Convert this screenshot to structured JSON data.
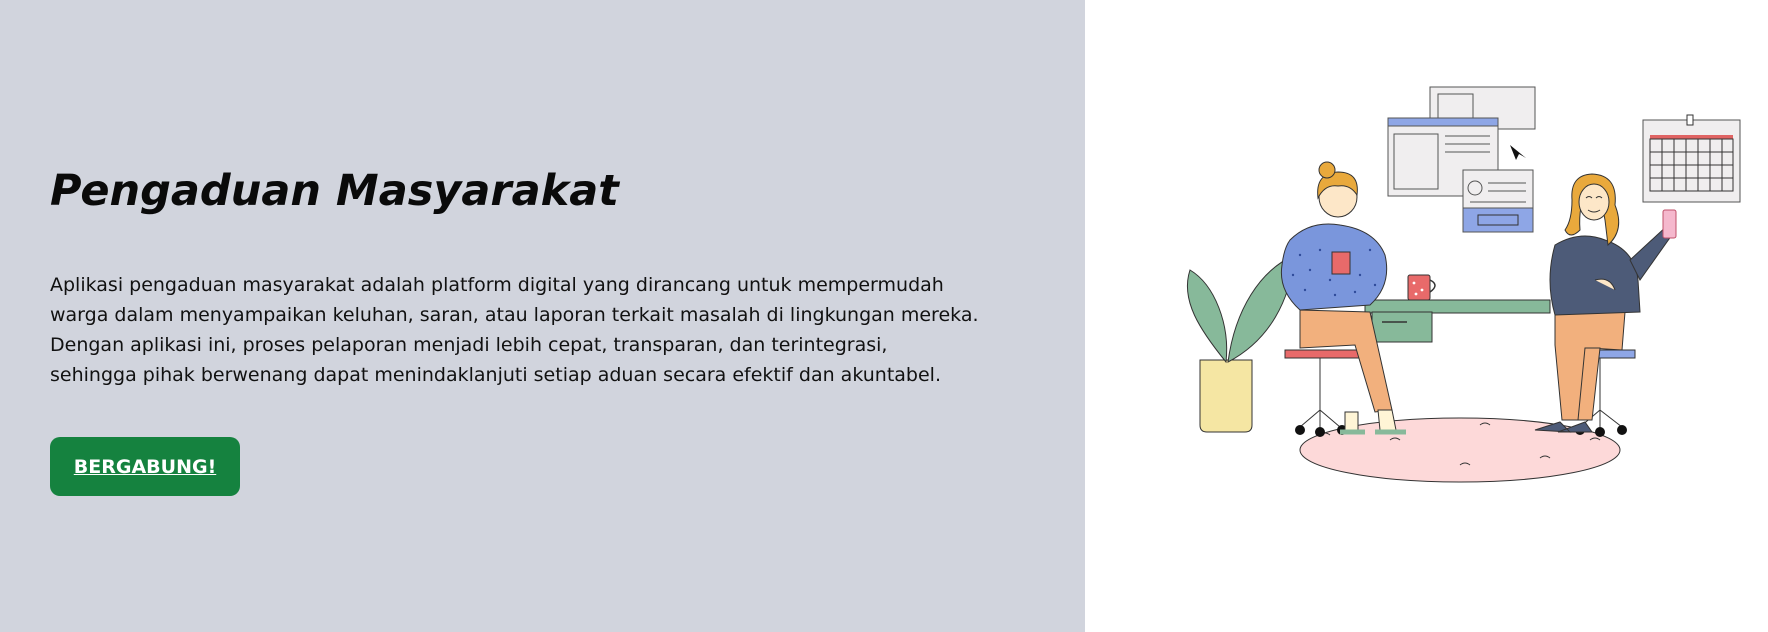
{
  "hero": {
    "title": "Pengaduan Masyarakat",
    "description_lines": [
      "Aplikasi pengaduan masyarakat adalah platform digital yang dirancang untuk mempermudah",
      "warga dalam menyampaikan keluhan, saran, atau laporan terkait masalah di lingkungan mereka.",
      "Dengan aplikasi ini, proses pelaporan menjadi lebih cepat, transparan, dan terintegrasi,",
      "sehingga pihak berwenang dapat menindaklanjuti setiap aduan secara efektif dan akuntabel."
    ],
    "button_label": "BERGABUNG!"
  },
  "colors": {
    "left_panel_bg": "#d1d4dd",
    "button_bg": "#15823f",
    "button_text": "#ffffff"
  }
}
